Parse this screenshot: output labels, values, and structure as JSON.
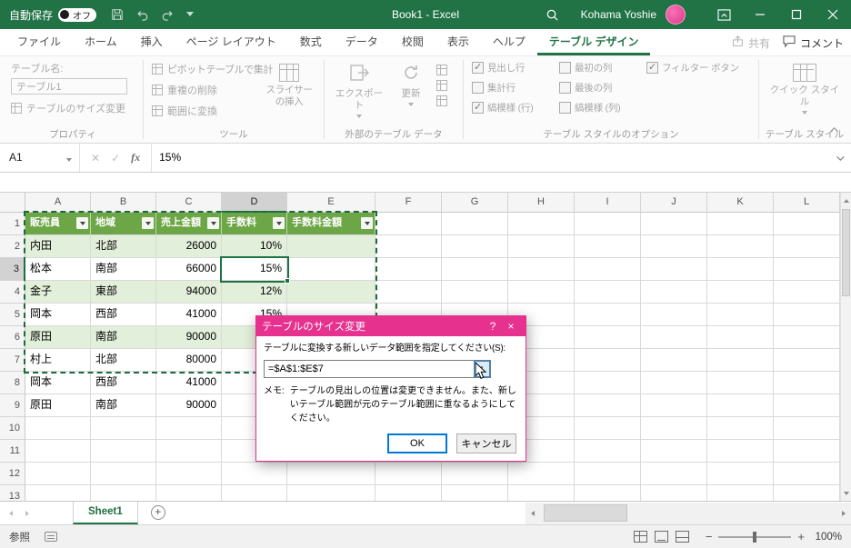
{
  "titlebar": {
    "autosave_label": "自動保存",
    "autosave_state": "オフ",
    "title": "Book1 - Excel",
    "user_name": "Kohama Yoshie"
  },
  "tabs": {
    "items": [
      "ファイル",
      "ホーム",
      "挿入",
      "ページ レイアウト",
      "数式",
      "データ",
      "校閲",
      "表示",
      "ヘルプ",
      "テーブル デザイン"
    ],
    "active": "テーブル デザイン",
    "share_label": "共有",
    "comments_label": "コメント"
  },
  "ribbon": {
    "table_name_label": "テーブル名:",
    "table_name_value": "テーブル1",
    "resize_table_label": "テーブルのサイズ変更",
    "properties_group_label": "プロパティ",
    "summarize_pivot_label": "ピボットテーブルで集計",
    "remove_duplicates_label": "重複の削除",
    "convert_range_label": "範囲に変換",
    "insert_slicer_label": "スライサーの挿入",
    "tools_group_label": "ツール",
    "export_label": "エクスポート",
    "refresh_label": "更新",
    "external_group_label": "外部のテーブル データ",
    "style_options": [
      {
        "label": "見出し行",
        "checked": true
      },
      {
        "label": "集計行",
        "checked": false
      },
      {
        "label": "縞模様 (行)",
        "checked": true
      },
      {
        "label": "最初の列",
        "checked": false
      },
      {
        "label": "最後の列",
        "checked": false
      },
      {
        "label": "縞模様 (列)",
        "checked": false
      },
      {
        "label": "フィルター ボタン",
        "checked": true
      }
    ],
    "style_options_group_label": "テーブル スタイルのオプション",
    "quick_styles_label": "クイック スタイル",
    "table_styles_group_label": "テーブル スタイル"
  },
  "formula_bar": {
    "name_box": "A1",
    "value": "15%"
  },
  "grid": {
    "column_letters": [
      "A",
      "B",
      "C",
      "D",
      "E",
      "F",
      "G",
      "H",
      "I",
      "J",
      "K",
      "L"
    ],
    "row_numbers": [
      1,
      2,
      3,
      4,
      5,
      6,
      7,
      8,
      9,
      10,
      11,
      12,
      13
    ],
    "table_header": [
      "販売員",
      "地域",
      "売上金額",
      "手数料",
      "手数料金額"
    ],
    "rows": [
      [
        "内田",
        "北部",
        "26000",
        "10%",
        ""
      ],
      [
        "松本",
        "南部",
        "66000",
        "15%",
        ""
      ],
      [
        "金子",
        "東部",
        "94000",
        "12%",
        ""
      ],
      [
        "岡本",
        "西部",
        "41000",
        "15%",
        ""
      ],
      [
        "原田",
        "南部",
        "90000",
        "",
        ""
      ],
      [
        "村上",
        "北部",
        "80000",
        "",
        ""
      ],
      [
        "岡本",
        "西部",
        "41000",
        "",
        ""
      ],
      [
        "原田",
        "南部",
        "90000",
        "",
        ""
      ]
    ],
    "selected_cell": "D3",
    "table_range": "A1:E7"
  },
  "dialog": {
    "title": "テーブルのサイズ変更",
    "help_icon": "?",
    "close_icon": "×",
    "prompt": "テーブルに変換する新しいデータ範囲を指定してください(S):",
    "range_value": "=$A$1:$E$7",
    "range_selector_icon": "↑",
    "note_label": "メモ:",
    "note_text": "テーブルの見出しの位置は変更できません。また、新しいテーブル範囲が元のテーブル範囲に重なるようにしてください。",
    "ok_label": "OK",
    "cancel_label": "キャンセル"
  },
  "sheet_bar": {
    "active_sheet": "Sheet1",
    "add_sheet_icon": "+"
  },
  "status_bar": {
    "mode": "参照",
    "zoom_out_icon": "−",
    "zoom_in_icon": "+",
    "zoom": "100%"
  },
  "icons_text": {
    "formula_cancel": "✕",
    "formula_enter": "✓",
    "fx": "fx"
  },
  "colors": {
    "excel_green": "#217346",
    "table_header_green": "#6DA647",
    "banded_row_green": "#E2EFDA",
    "dialog_magenta": "#E6318F",
    "focus_blue": "#0078D7"
  }
}
